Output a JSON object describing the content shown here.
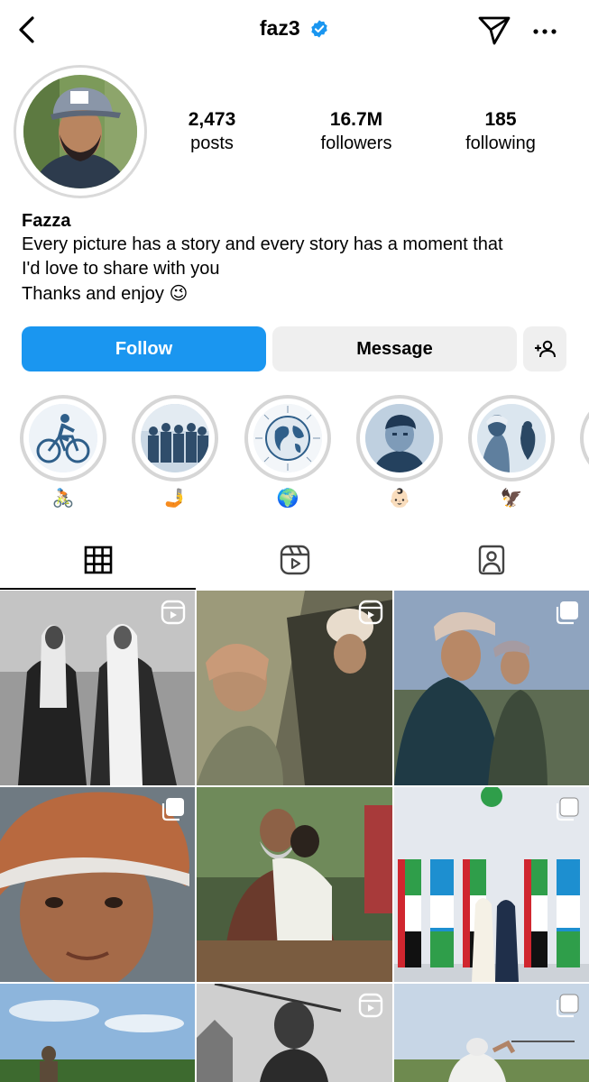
{
  "header": {
    "username": "faz3",
    "back_icon": "chevron-left-icon",
    "verified_icon": "verified-badge-icon",
    "send_icon": "paper-plane-icon",
    "more_icon": "more-horizontal-icon"
  },
  "profile": {
    "display_name": "Fazza",
    "bio_lines": [
      "Every picture has a story and every story has a moment that",
      "I'd love to share with you",
      "Thanks and enjoy"
    ],
    "bio_emoji": "😉",
    "stats": [
      {
        "value": "2,473",
        "label": "posts"
      },
      {
        "value": "16.7M",
        "label": "followers"
      },
      {
        "value": "185",
        "label": "following"
      }
    ]
  },
  "actions": {
    "follow_label": "Follow",
    "message_label": "Message",
    "add_person_icon": "add-person-icon"
  },
  "highlights": [
    {
      "label": "🚴🏻",
      "icon": "cyclist-illustration"
    },
    {
      "label": "🤳",
      "icon": "group-photo"
    },
    {
      "label": "🌍",
      "icon": "globe-illustration"
    },
    {
      "label": "👶🏻",
      "icon": "child-portrait"
    },
    {
      "label": "🦅",
      "icon": "falcon-photo"
    }
  ],
  "tabs": [
    {
      "name": "grid",
      "icon": "grid-icon",
      "active": true
    },
    {
      "name": "reels",
      "icon": "reels-icon",
      "active": false
    },
    {
      "name": "tagged",
      "icon": "tagged-person-icon",
      "active": false
    }
  ],
  "colors": {
    "accent": "#1a96f0",
    "button_gray": "#efefef",
    "verified": "#1a96f0"
  }
}
